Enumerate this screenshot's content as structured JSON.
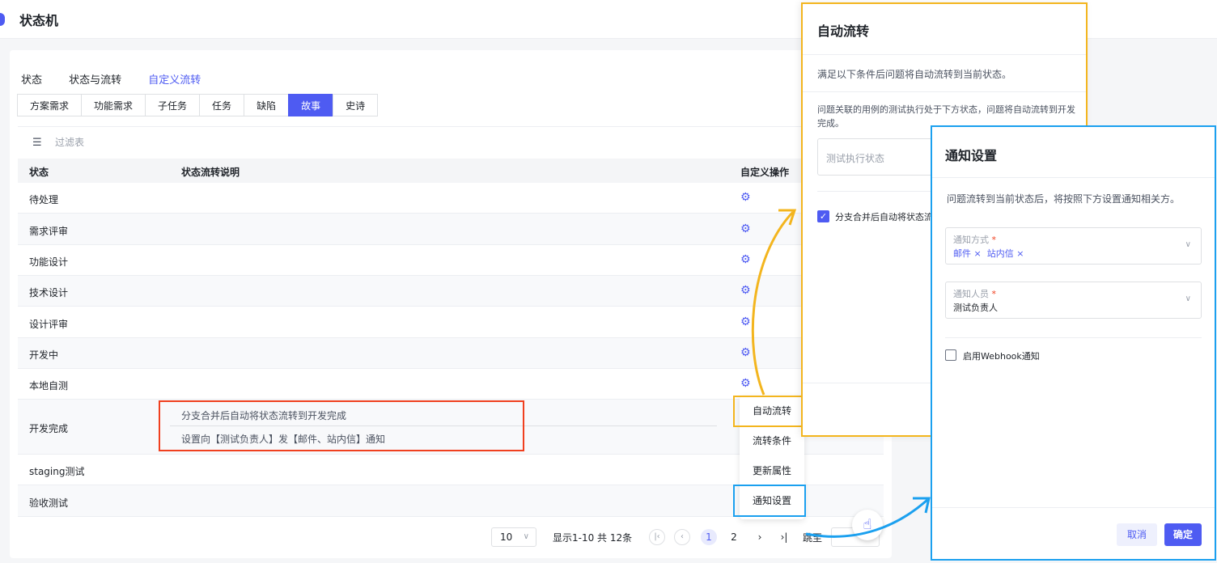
{
  "header": {
    "title": "状态机"
  },
  "tabs": [
    "状态",
    "状态与流转",
    "自定义流转"
  ],
  "subtabs": [
    "方案需求",
    "功能需求",
    "子任务",
    "任务",
    "缺陷",
    "故事",
    "史诗"
  ],
  "filter": {
    "label": "过滤表"
  },
  "table": {
    "columns": [
      "状态",
      "状态流转说明",
      "自定义操作"
    ],
    "rows": [
      {
        "name": "待处理"
      },
      {
        "name": "需求评审"
      },
      {
        "name": "功能设计"
      },
      {
        "name": "技术设计"
      },
      {
        "name": "设计评审"
      },
      {
        "name": "开发中"
      },
      {
        "name": "本地自测"
      },
      {
        "name": "开发完成",
        "desc1": "分支合并后自动将状态流转到开发完成",
        "desc2": "设置向【测试负责人】发【邮件、站内信】通知"
      },
      {
        "name": "staging测试"
      },
      {
        "name": "验收测试"
      }
    ]
  },
  "menu": [
    "自动流转",
    "流转条件",
    "更新属性",
    "通知设置"
  ],
  "pagination": {
    "page_size": "10",
    "info": "显示1-10 共 12条",
    "pages": [
      "1",
      "2"
    ],
    "jump_label": "跳至"
  },
  "auto_panel": {
    "title": "自动流转",
    "desc": "满足以下条件后问题将自动流转到当前状态。",
    "test_desc": "问题关联的用例的测试执行处于下方状态，问题将自动流转到开发完成。",
    "test_placeholder": "测试执行状态",
    "merge_label": "分支合并后自动将状态流"
  },
  "notify_panel": {
    "title": "通知设置",
    "desc": "问题流转到当前状态后，将按照下方设置通知相关方。",
    "method_label": "通知方式",
    "method_tags": [
      "邮件",
      "站内信"
    ],
    "person_label": "通知人员",
    "person_value": "测试负责人",
    "webhook_label": "启用Webhook通知",
    "cancel": "取消",
    "ok": "确定"
  },
  "colors": {
    "accent": "#4e5bf2",
    "highlight_yellow": "#f3b51e",
    "highlight_blue": "#1ba0ef",
    "highlight_red": "#f0401f"
  },
  "icons": {
    "gear": "gear-icon",
    "filter": "filter-icon",
    "chevron": "chevron-down-icon",
    "hand": "pointer-hand-icon"
  }
}
